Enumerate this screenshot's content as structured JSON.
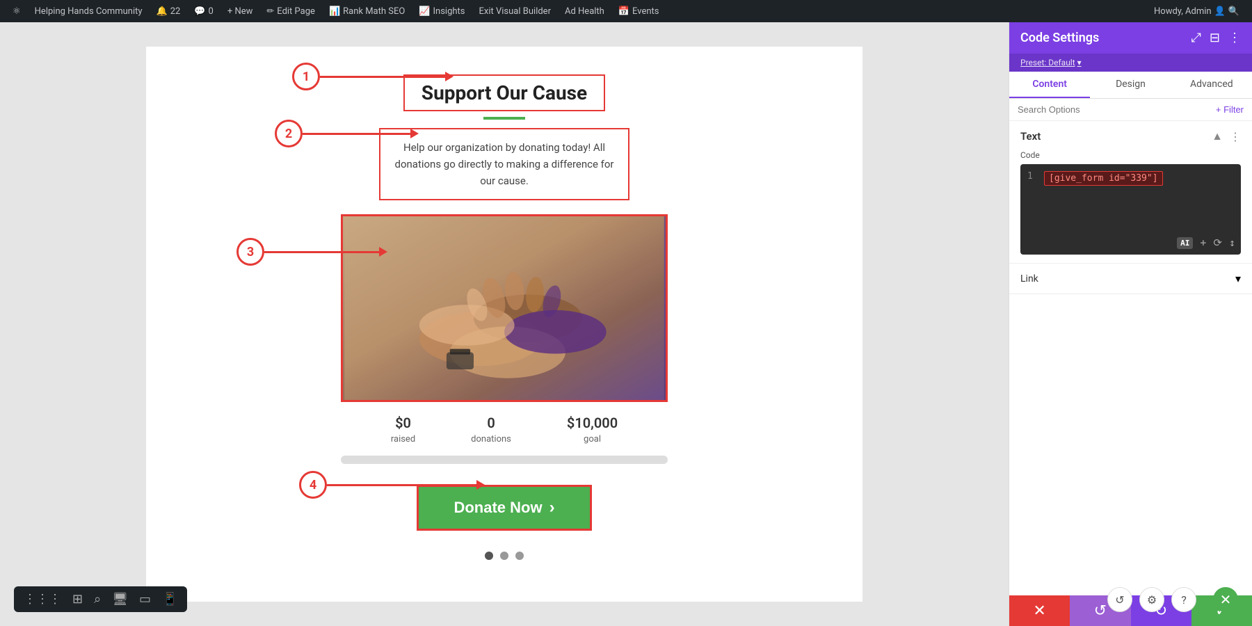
{
  "adminbar": {
    "site_name": "Helping Hands Community",
    "updates_count": "22",
    "comments_count": "0",
    "new_label": "+ New",
    "edit_page": "Edit Page",
    "rank_math": "Rank Math SEO",
    "insights": "Insights",
    "exit_builder": "Exit Visual Builder",
    "ad_health": "Ad Health",
    "events": "Events",
    "howdy": "Howdy, Admin"
  },
  "page": {
    "title": "Support Our Cause",
    "description": "Help our organization by donating today! All donations go directly to making a difference for our cause.",
    "stats": [
      {
        "value": "$0",
        "label": "raised"
      },
      {
        "value": "0",
        "label": "donations"
      },
      {
        "value": "$10,000",
        "label": "goal"
      }
    ],
    "donate_button": "Donate Now",
    "progress_percent": 0
  },
  "annotations": [
    {
      "number": "1"
    },
    {
      "number": "2"
    },
    {
      "number": "3"
    },
    {
      "number": "4"
    }
  ],
  "panel": {
    "title": "Code Settings",
    "preset_label": "Preset: Default",
    "tabs": [
      "Content",
      "Design",
      "Advanced"
    ],
    "active_tab": "Content",
    "search_placeholder": "Search Options",
    "filter_label": "+ Filter",
    "section_title": "Text",
    "code_label": "Code",
    "code_line_num": "1",
    "code_snippet": "[give_form id=\"339\"]",
    "link_label": "Link",
    "action_icons": {
      "cancel": "✕",
      "undo": "↺",
      "redo": "↻",
      "confirm": "✓"
    }
  },
  "bottom_toolbar": {
    "icons": [
      "⋮⋮⋮",
      "⊞",
      "⌕",
      "🖥",
      "▭",
      "📱"
    ]
  },
  "icons": {
    "wordpress": "W",
    "expand": "⤢",
    "columns": "⊟",
    "more_vert": "⋮",
    "chevron_up": "▲",
    "chevron_down": "▾",
    "ai": "AI",
    "plus": "+",
    "reset": "⟳",
    "sort": "↕",
    "search": "🔍",
    "circle_refresh": "↺",
    "circle_settings": "⚙",
    "question": "?"
  }
}
